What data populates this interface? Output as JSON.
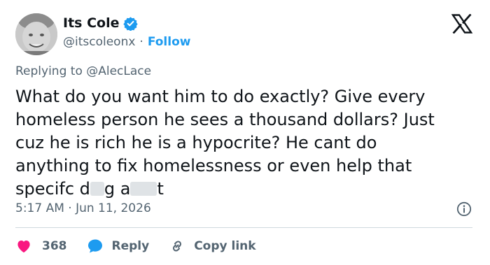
{
  "author": {
    "display_name": "Its Cole",
    "handle": "@itscoleonx",
    "separator": "·",
    "follow_label": "Follow",
    "verified_color": "#1d9bf0"
  },
  "reply_to": "Replying to @AlecLace",
  "tweet": {
    "line1": "What do you want him to do exactly? Give every",
    "line2": "homeless person he sees a thousand dollars? Just",
    "line3": "cuz he is rich he is a hypocrite? He cant do",
    "line4": "anything to fix homelessness or even help that",
    "line5_a": "specifc d",
    "line5_b": "g a",
    "line5_c": "t"
  },
  "timestamp": "5:17 AM · Jun 11, 2026",
  "actions": {
    "like_count": "368",
    "reply_label": "Reply",
    "copy_link_label": "Copy link"
  },
  "colors": {
    "accent": "#1d9bf0",
    "like": "#f91880",
    "muted_text": "#536471"
  },
  "icons": [
    "x-logo-icon",
    "verified-badge-icon",
    "info-icon",
    "heart-icon",
    "reply-bubble-icon",
    "link-icon"
  ]
}
